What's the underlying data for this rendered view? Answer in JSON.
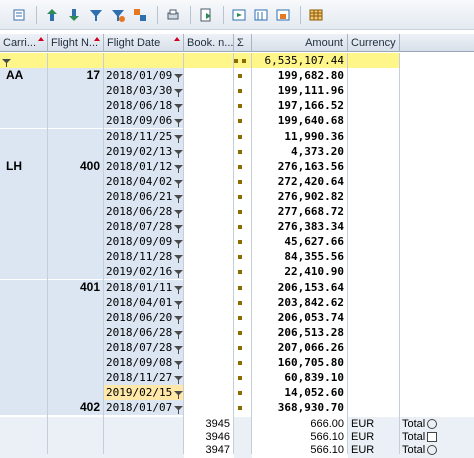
{
  "toolbar": {
    "icons": [
      "details-icon",
      "sort-ascending-icon",
      "sort-descending-icon",
      "filter-icon",
      "subtotal-icon",
      "print-icon",
      "export-icon",
      "change-layout-icon",
      "select-layout-icon",
      "save-layout-icon",
      "grid-icon"
    ]
  },
  "columns": {
    "carrier": "Carri...",
    "flight": "Flight N...",
    "date": "Flight Date",
    "booking": "Book. n...",
    "sigma": "Σ",
    "amount": "Amount",
    "currency": "Currency"
  },
  "grand_total": "6,535,107.44",
  "groups": [
    {
      "carrier": "AA",
      "flight": "17",
      "date": "2018/01/09",
      "amount": "199,682.80"
    },
    {
      "carrier": "",
      "flight": "",
      "date": "2018/03/30",
      "amount": "199,111.96"
    },
    {
      "carrier": "",
      "flight": "",
      "date": "2018/06/18",
      "amount": "197,166.52"
    },
    {
      "carrier": "",
      "flight": "",
      "date": "2018/09/06",
      "amount": "199,640.68"
    },
    {
      "carrier": "",
      "flight": "",
      "date": "2018/11/25",
      "amount": "11,990.36"
    },
    {
      "carrier": "",
      "flight": "",
      "date": "2019/02/13",
      "amount": "4,373.20"
    },
    {
      "carrier": "LH",
      "flight": "400",
      "date": "2018/01/12",
      "amount": "276,163.56"
    },
    {
      "carrier": "",
      "flight": "",
      "date": "2018/04/02",
      "amount": "272,420.64"
    },
    {
      "carrier": "",
      "flight": "",
      "date": "2018/06/21",
      "amount": "276,902.82"
    },
    {
      "carrier": "",
      "flight": "",
      "date": "2018/06/28",
      "amount": "277,668.72"
    },
    {
      "carrier": "",
      "flight": "",
      "date": "2018/07/28",
      "amount": "276,383.34"
    },
    {
      "carrier": "",
      "flight": "",
      "date": "2018/09/09",
      "amount": "45,627.66"
    },
    {
      "carrier": "",
      "flight": "",
      "date": "2018/11/28",
      "amount": "84,355.56"
    },
    {
      "carrier": "",
      "flight": "",
      "date": "2019/02/16",
      "amount": "22,410.90"
    },
    {
      "carrier": "",
      "flight": "401",
      "date": "2018/01/11",
      "amount": "206,153.64"
    },
    {
      "carrier": "",
      "flight": "",
      "date": "2018/04/01",
      "amount": "203,842.62"
    },
    {
      "carrier": "",
      "flight": "",
      "date": "2018/06/20",
      "amount": "206,053.74"
    },
    {
      "carrier": "",
      "flight": "",
      "date": "2018/06/28",
      "amount": "206,513.28"
    },
    {
      "carrier": "",
      "flight": "",
      "date": "2018/07/28",
      "amount": "207,066.26"
    },
    {
      "carrier": "",
      "flight": "",
      "date": "2018/09/08",
      "amount": "160,705.80"
    },
    {
      "carrier": "",
      "flight": "",
      "date": "2018/11/27",
      "amount": "60,839.10"
    },
    {
      "carrier": "",
      "flight": "",
      "date": "2019/02/15",
      "amount": "14,052.60"
    },
    {
      "carrier": "",
      "flight": "402",
      "date": "2018/01/07",
      "amount": "368,930.70"
    }
  ],
  "details": [
    {
      "booking": "3945",
      "amount": "666.00",
      "currency": "EUR",
      "total_label": "Total",
      "control": "radio"
    },
    {
      "booking": "3946",
      "amount": "566.10",
      "currency": "EUR",
      "total_label": "Total",
      "control": "checkbox"
    },
    {
      "booking": "3947",
      "amount": "566.10",
      "currency": "EUR",
      "total_label": "Total",
      "control": "radio"
    }
  ],
  "colors": {
    "total_row": "#fff68a",
    "group_column": "#dbe6f2",
    "sort_indicator": "#d0001c"
  }
}
